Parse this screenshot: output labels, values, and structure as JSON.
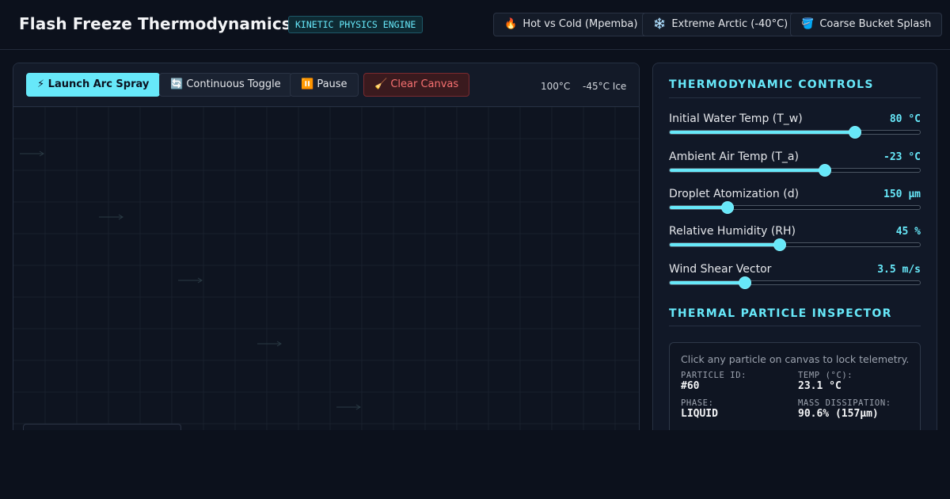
{
  "header": {
    "title": "Flash Freeze Thermodynamics",
    "badge": "KINETIC PHYSICS ENGINE",
    "presets": [
      {
        "icon": "🔥",
        "icon_name": "fire-icon",
        "label": "Hot vs Cold (Mpemba)"
      },
      {
        "icon": "❄️",
        "icon_name": "snowflake-icon",
        "label": "Extreme Arctic (-40°C)"
      },
      {
        "icon": "🪣",
        "icon_name": "bucket-icon",
        "label": "Coarse Bucket Splash"
      }
    ]
  },
  "toolbar": {
    "launch": {
      "icon": "⚡",
      "icon_name": "lightning-icon",
      "label": "Launch Arc Spray"
    },
    "continuous": {
      "icon": "🔄",
      "icon_name": "refresh-icon",
      "label": "Continuous Toggle"
    },
    "pause": {
      "icon": "⏸️",
      "icon_name": "pause-icon",
      "label": "Pause"
    },
    "clear": {
      "icon": "🧹",
      "icon_name": "broom-icon",
      "label": "Clear Canvas"
    },
    "scale_hot": "100°C",
    "scale_cold": "-45°C Ice"
  },
  "controls": {
    "title": "THERMODYNAMIC CONTROLS",
    "sliders": [
      {
        "label": "Initial Water Temp (T_w)",
        "value": "80 °C",
        "level": 0.74
      },
      {
        "label": "Ambient Air Temp (T_a)",
        "value": "-23 °C",
        "level": 0.62
      },
      {
        "label": "Droplet Atomization (d)",
        "value": "150 µm",
        "level": 0.23
      },
      {
        "label": "Relative Humidity (RH)",
        "value": "45 %",
        "level": 0.44
      },
      {
        "label": "Wind Shear Vector",
        "value": "3.5 m/s",
        "level": 0.3
      }
    ]
  },
  "inspector": {
    "title": "THERMAL PARTICLE INSPECTOR",
    "hint": "Click any particle on canvas to lock telemetry.",
    "particle_id_label": "PARTICLE ID:",
    "particle_id": "#60",
    "temp_label": "TEMP (°C):",
    "temp": "23.1 °C",
    "phase_label": "PHASE:",
    "phase": "LIQUID",
    "mass_label": "MASS DISSIPATION:",
    "mass": "90.6% (157µm)"
  },
  "colors": {
    "accent": "#67e8f9",
    "danger": "#f87171",
    "background": "#0c111c",
    "panel": "#111827",
    "grid": "#1a2230"
  }
}
